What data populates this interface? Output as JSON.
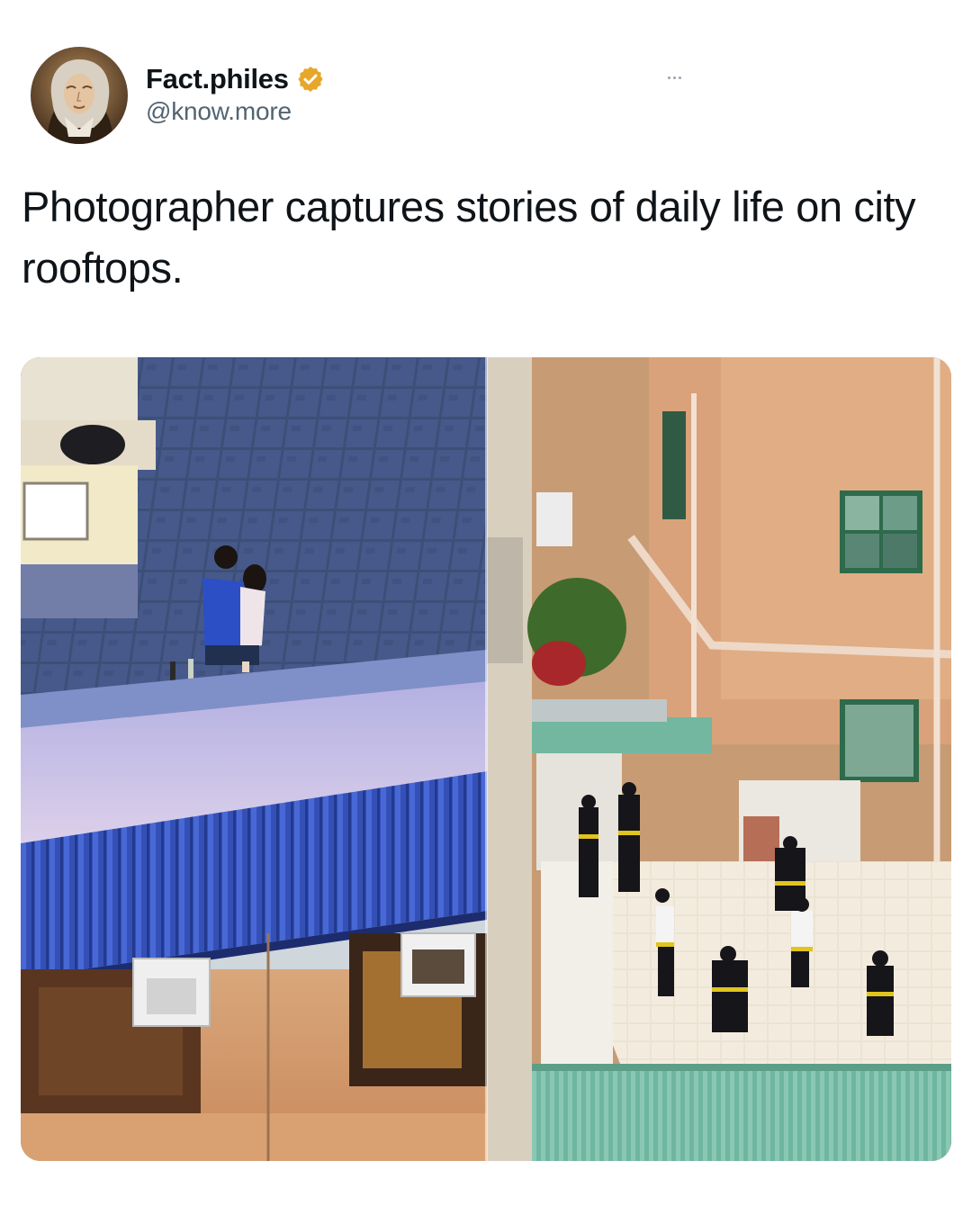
{
  "user": {
    "display_name": "Fact.philes",
    "handle": "@know.more",
    "verified": true,
    "badge_color": "#e8a72b"
  },
  "tweet": {
    "text": "Photographer captures stories of daily life on city rooftops."
  },
  "icons": {
    "verified": "verified-badge-icon",
    "more": "more-options-icon"
  },
  "media": {
    "count": 2
  }
}
